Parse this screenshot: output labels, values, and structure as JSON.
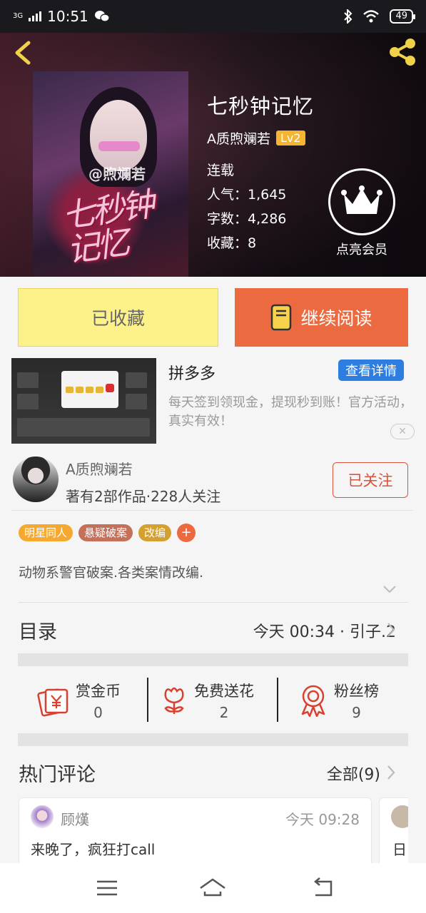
{
  "status_bar": {
    "network": "3G",
    "time": "10:51",
    "battery": "49"
  },
  "book": {
    "title": "七秒钟记忆",
    "author": "A质煦斓若",
    "level": "Lv2",
    "status": "连载",
    "popularity": "人气：1,645",
    "word_count": "字数：4,286",
    "favorites": "收藏：8",
    "cover_watermark": "@煦斓若",
    "cover_title": "七秒钟记忆"
  },
  "vip": {
    "label": "点亮会员"
  },
  "actions": {
    "favorited_label": "已收藏",
    "continue_label": "继续阅读"
  },
  "ad": {
    "name": "拼多多",
    "button": "查看详情",
    "description": "每天签到领现金，提现秒到账！官方活动，真实有效！",
    "close": "✕"
  },
  "author_card": {
    "name": "A质煦斓若",
    "stats": "著有2部作品·228人关注",
    "follow_label": "已关注"
  },
  "tags": [
    {
      "label": "明星同人",
      "color": "#f5a930"
    },
    {
      "label": "悬疑破案",
      "color": "#c4705a"
    },
    {
      "label": "改编",
      "color": "#d4a030"
    }
  ],
  "tag_add": "+",
  "description": "动物系警官破案.各类案情改编.",
  "toc": {
    "label": "目录",
    "info": "今天 00:34 · 引子.2"
  },
  "stats": [
    {
      "name": "赏金币",
      "value": "0",
      "icon": "reward-coin-icon"
    },
    {
      "name": "免费送花",
      "value": "2",
      "icon": "flower-icon"
    },
    {
      "name": "粉丝榜",
      "value": "9",
      "icon": "medal-icon"
    }
  ],
  "hot_comments": {
    "label": "热门评论",
    "all_label": "全部(9)",
    "items": [
      {
        "user": "顾熯",
        "time": "今天 09:28",
        "text": "来晚了，疯狂打call"
      },
      {
        "user": "",
        "time": "",
        "text": "日"
      }
    ]
  },
  "colors": {
    "accent": "#ec6a3f",
    "favorite_bg": "#fdf289",
    "link_blue": "#2e7de0",
    "follow_red": "#d8533d"
  }
}
